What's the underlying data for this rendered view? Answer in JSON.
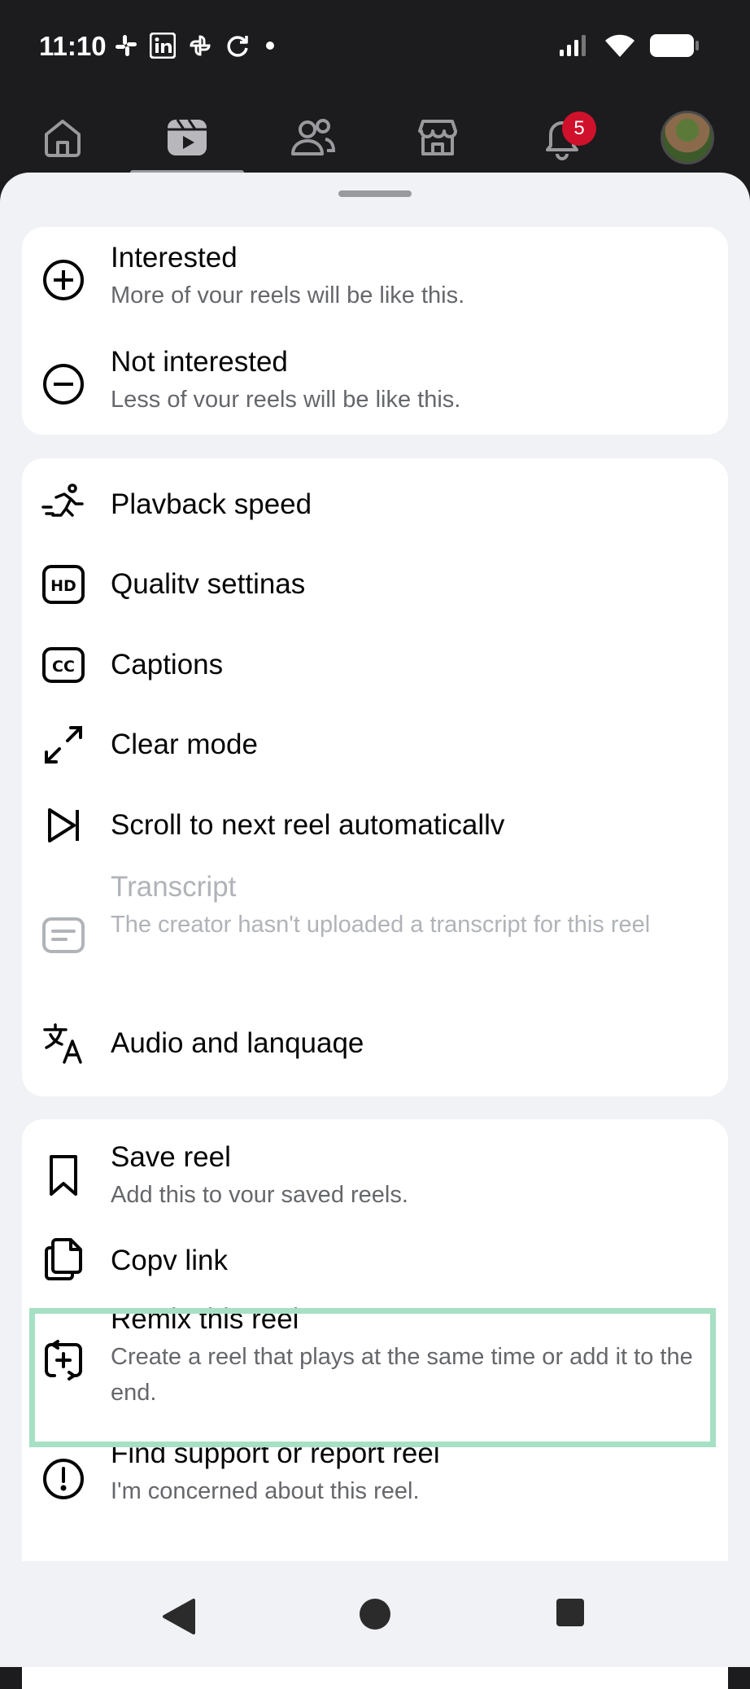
{
  "status": {
    "time": "11:10"
  },
  "nav": {
    "items": [
      {
        "name": "home-icon"
      },
      {
        "name": "reels-icon"
      },
      {
        "name": "friends-icon"
      },
      {
        "name": "marketplace-icon"
      },
      {
        "name": "notifications-icon"
      },
      {
        "name": "profile-avatar"
      }
    ],
    "notification_badge": "5"
  },
  "menu": {
    "group1": [
      {
        "title": "Interested",
        "subtitle": "More of vour reels will be like this.",
        "icon": "plus-circle-icon"
      },
      {
        "title": "Not interested",
        "subtitle": "Less of vour reels will be like this.",
        "icon": "minus-circle-icon"
      }
    ],
    "group2": [
      {
        "title": "Plavback speed",
        "icon": "running-person-icon"
      },
      {
        "title": "Qualitv settinas",
        "icon": "hd-icon"
      },
      {
        "title": "Captions",
        "icon": "cc-icon"
      },
      {
        "title": "Clear mode",
        "icon": "expand-arrows-icon"
      },
      {
        "title": "Scroll to next reel automaticallv",
        "icon": "skip-next-icon"
      },
      {
        "title": "Transcript",
        "subtitle": "The creator hasn't uploaded a transcript for this reel",
        "icon": "transcript-icon",
        "disabled": true
      },
      {
        "title": "Audio and lanquaqe",
        "icon": "translate-icon"
      }
    ],
    "group3": [
      {
        "title": "Save reel",
        "subtitle": "Add this to vour saved reels.",
        "icon": "bookmark-icon"
      },
      {
        "title": "Copv link",
        "icon": "copy-link-icon"
      },
      {
        "title": "Remix this reel",
        "subtitle": "Create a reel that plays at the same time or add it to the end.",
        "icon": "remix-icon"
      },
      {
        "title": "Find support or report reel",
        "subtitle": "I'm concerned about this reel.",
        "icon": "alert-circle-icon"
      }
    ]
  },
  "colors": {
    "highlight": "#a6e0c5",
    "badge": "#d0112b"
  }
}
